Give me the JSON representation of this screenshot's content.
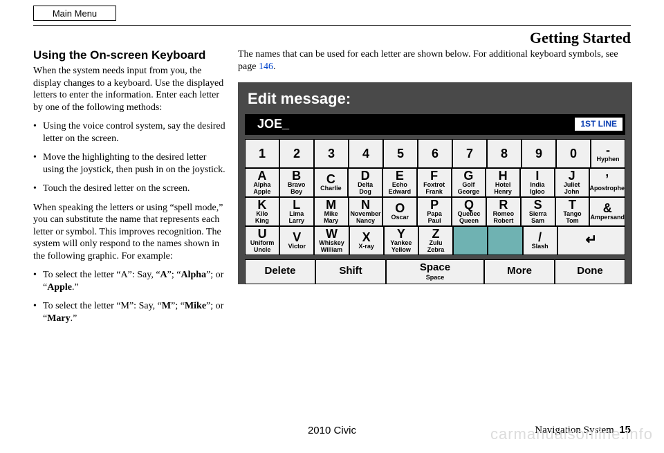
{
  "main_menu_label": "Main Menu",
  "header_title": "Getting Started",
  "left": {
    "h2": "Using the On-screen Keyboard",
    "para1": "When the system needs input from you, the display changes to a keyboard. Use the displayed letters to enter the information. Enter each letter by one of the following methods:",
    "methods": [
      "Using the voice control system, say the desired letter on the screen.",
      "Move the highlighting to the desired letter using the joystick, then push in on the joystick.",
      "Touch the desired letter on the screen."
    ],
    "para2": "When speaking the letters or using “spell mode,” you can substitute the name that represents each letter or symbol. This improves recognition. The system will only respond to the names shown in the following graphic. For example:",
    "example_a_pre": "To select the letter “A”: Say, “",
    "example_a_bold1": "A",
    "example_a_mid1": "”; “",
    "example_a_bold2": "Alpha",
    "example_a_mid2": "”; or “",
    "example_a_bold3": "Apple",
    "example_a_end": ".”",
    "example_m_pre": "To select the letter “M”: Say, “",
    "example_m_bold1": "M",
    "example_m_mid1": "”; “",
    "example_m_bold2": "Mike",
    "example_m_mid2": "”; or “",
    "example_m_bold3": "Mary",
    "example_m_end": ".”"
  },
  "right": {
    "intro_pre": "The names that can be used for each letter are shown below. For additional keyboard symbols, see page ",
    "intro_link": "146",
    "intro_post": "."
  },
  "keyboard": {
    "title": "Edit message:",
    "input_value": "JOE_",
    "line_badge": "1ST LINE",
    "row1": [
      {
        "big": "1"
      },
      {
        "big": "2"
      },
      {
        "big": "3"
      },
      {
        "big": "4"
      },
      {
        "big": "5"
      },
      {
        "big": "6"
      },
      {
        "big": "7"
      },
      {
        "big": "8"
      },
      {
        "big": "9"
      },
      {
        "big": "0"
      },
      {
        "big": "-",
        "sub": "Hyphen"
      }
    ],
    "row2": [
      {
        "big": "A",
        "sub": "Alpha\nApple"
      },
      {
        "big": "B",
        "sub": "Bravo\nBoy"
      },
      {
        "big": "C",
        "sub": "Charlie"
      },
      {
        "big": "D",
        "sub": "Delta\nDog"
      },
      {
        "big": "E",
        "sub": "Echo\nEdward"
      },
      {
        "big": "F",
        "sub": "Foxtrot\nFrank"
      },
      {
        "big": "G",
        "sub": "Golf\nGeorge"
      },
      {
        "big": "H",
        "sub": "Hotel\nHenry"
      },
      {
        "big": "I",
        "sub": "India\nIgloo"
      },
      {
        "big": "J",
        "sub": "Juliet\nJohn"
      },
      {
        "big": "’",
        "sub": "Apostrophe"
      }
    ],
    "row3": [
      {
        "big": "K",
        "sub": "Kilo\nKing"
      },
      {
        "big": "L",
        "sub": "Lima\nLarry"
      },
      {
        "big": "M",
        "sub": "Mike\nMary"
      },
      {
        "big": "N",
        "sub": "November\nNancy"
      },
      {
        "big": "O",
        "sub": "Oscar"
      },
      {
        "big": "P",
        "sub": "Papa\nPaul"
      },
      {
        "big": "Q",
        "sub": "Quebec\nQueen"
      },
      {
        "big": "R",
        "sub": "Romeo\nRobert"
      },
      {
        "big": "S",
        "sub": "Sierra\nSam"
      },
      {
        "big": "T",
        "sub": "Tango\nTom"
      },
      {
        "big": "&",
        "sub": "Ampersand"
      }
    ],
    "row4": [
      {
        "big": "U",
        "sub": "Uniform\nUncle"
      },
      {
        "big": "V",
        "sub": "Victor"
      },
      {
        "big": "W",
        "sub": "Whiskey\nWilliam"
      },
      {
        "big": "X",
        "sub": "X-ray"
      },
      {
        "big": "Y",
        "sub": "Yankee\nYellow"
      },
      {
        "big": "Z",
        "sub": "Zulu\nZebra"
      },
      {
        "disabled": true
      },
      {
        "disabled": true
      },
      {
        "big": "/",
        "sub": "Slash"
      },
      {
        "enter": true
      }
    ],
    "bottom": {
      "delete": "Delete",
      "shift": "Shift",
      "space_big": "Space",
      "space_sub": "Space",
      "more": "More",
      "done": "Done"
    }
  },
  "footer": {
    "center": "2010 Civic",
    "right_label": "Navigation System",
    "page": "15"
  },
  "watermark": "carmanualsonline.info"
}
